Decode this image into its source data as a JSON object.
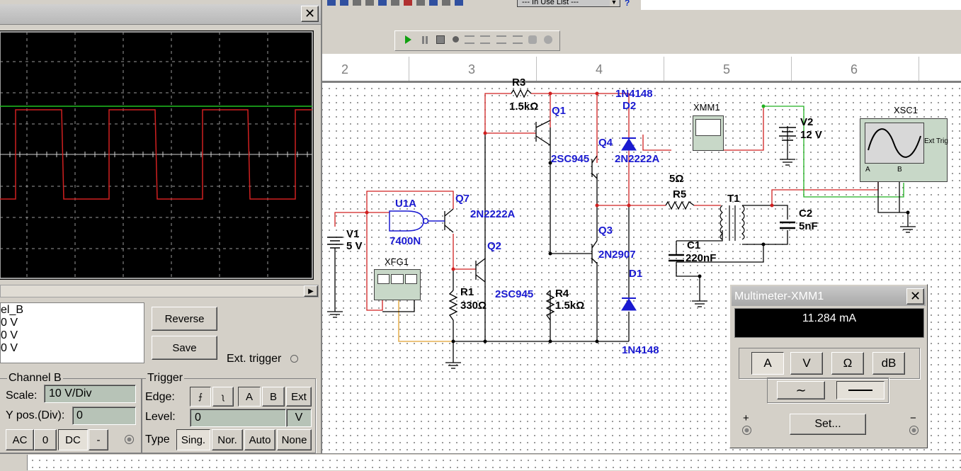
{
  "toolbar": {
    "in_use_list": "--- In Use List ---",
    "help": "?"
  },
  "ruler": {
    "cols": [
      "2",
      "3",
      "4",
      "5",
      "6"
    ]
  },
  "scope": {
    "close": "✕",
    "channel_table": {
      "header": "el_B",
      "rows": [
        "0 V",
        "0 V",
        "0 V"
      ]
    },
    "reverse_label": "Reverse",
    "save_label": "Save",
    "ext_trigger_label": "Ext. trigger",
    "channel_b": {
      "title": "Channel B",
      "scale_label": "Scale:",
      "scale_value": "10  V/Div",
      "ypos_label": "Y pos.(Div):",
      "ypos_value": "0",
      "coupling": [
        "AC",
        "0",
        "DC",
        "-"
      ]
    },
    "trigger": {
      "title": "Trigger",
      "edge_label": "Edge:",
      "edge_a": "A",
      "edge_b": "B",
      "edge_ext": "Ext",
      "level_label": "Level:",
      "level_value": "0",
      "level_unit": "V",
      "type_label": "Type",
      "types": [
        "Sing.",
        "Nor.",
        "Auto",
        "None"
      ]
    }
  },
  "schematic": {
    "labels": {
      "r3": "R3",
      "r3_val": "1.5kΩ",
      "q1": "Q1",
      "d2_part": "1N4148",
      "d2": "D2",
      "xmm1": "XMM1",
      "v2": "V2",
      "v2_val": "12 V",
      "xsc1": "XSC1",
      "ext_trig": "Ext Trig",
      "q4": "Q4",
      "q4_part": "2SC945",
      "q4_part2": "2N2222A",
      "q7": "Q7",
      "q7_part": "2N2222A",
      "u1a": "U1A",
      "u1a_part": "7400N",
      "v1": "V1",
      "v1_val": "5 V",
      "r5_val": "5Ω",
      "r5": "R5",
      "t1": "T1",
      "c2": "C2",
      "c2_val": "5nF",
      "q2": "Q2",
      "q3": "Q3",
      "q3_part": "2N2907",
      "c1": "C1",
      "c1_val": "220nF",
      "xfg1": "XFG1",
      "d1": "D1",
      "r1": "R1",
      "r1_val": "330Ω",
      "q2_part": "2SC945",
      "r4": "R4",
      "r4_val": "1.5kΩ",
      "d1_part": "1N4148",
      "scope_a": "A",
      "scope_b": "B"
    }
  },
  "multimeter": {
    "title": "Multimeter-XMM1",
    "close": "✕",
    "reading": "11.284 mA",
    "modes": [
      "A",
      "V",
      "Ω",
      "dB"
    ],
    "plus": "+",
    "minus": "−",
    "set_label": "Set..."
  }
}
